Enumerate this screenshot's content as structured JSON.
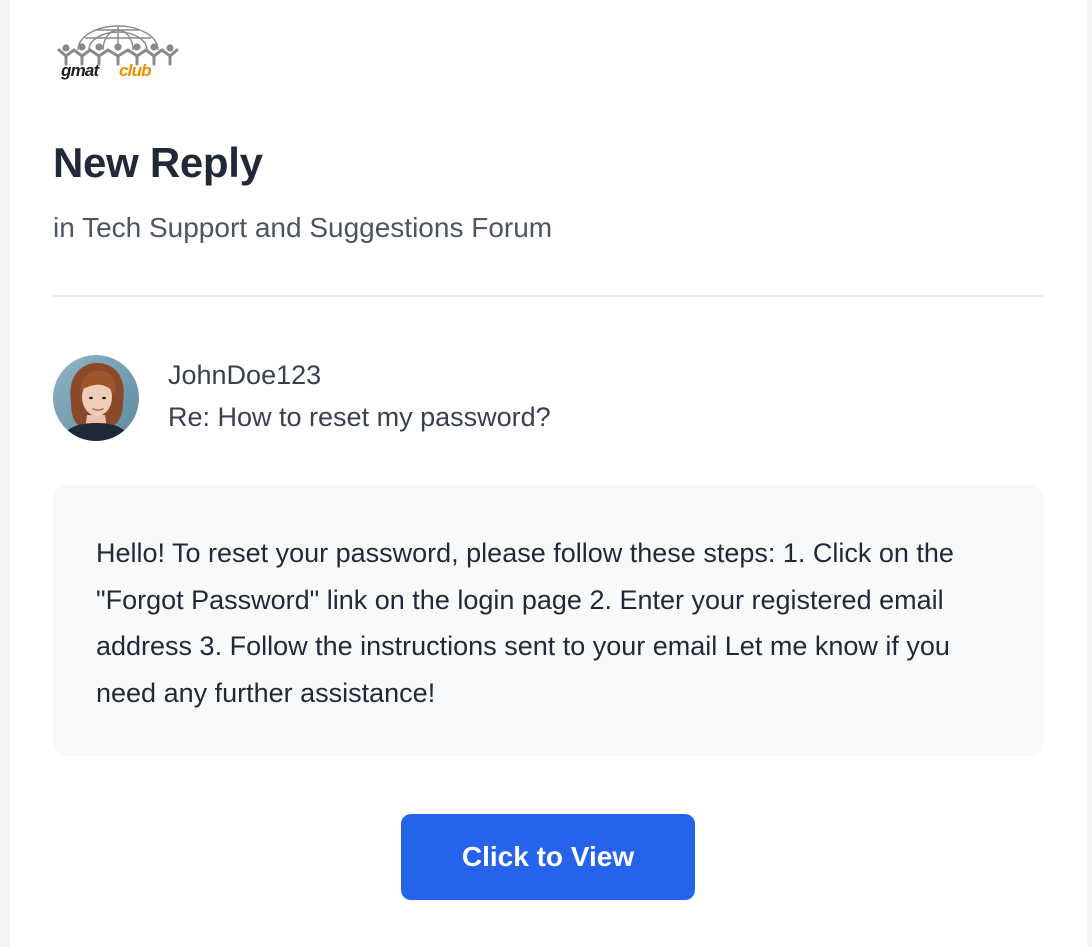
{
  "brand": {
    "logo_name": "gmatclub",
    "logo_part_1": "gmat",
    "logo_part_2": "club",
    "accent_color": "#f28c00"
  },
  "notification": {
    "title": "New Reply",
    "subtitle": "in Tech Support and Suggestions Forum"
  },
  "post": {
    "author": "JohnDoe123",
    "thread_title": "Re: How to reset my password?",
    "avatar_icon": "user-avatar-photo",
    "message": "Hello! To reset your password, please follow these steps: 1. Click on the \"Forgot Password\" link on the login page 2. Enter your registered email address 3. Follow the instructions sent to your email Let me know if you need any further assistance!"
  },
  "actions": {
    "view_label": "Click to View",
    "button_color": "#2563eb"
  }
}
